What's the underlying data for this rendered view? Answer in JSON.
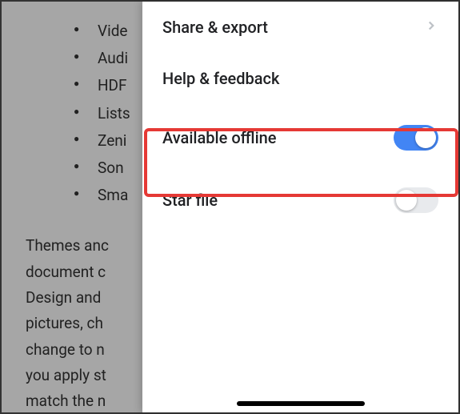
{
  "background": {
    "bullets": [
      "Vide",
      "Audi",
      "HDF",
      "Lists",
      "Zeni",
      "Son",
      "Sma"
    ],
    "paragraph": "Themes anc\ndocument c\nDesign and\npictures, ch\nchange to n\nyou apply st\nmatch the n"
  },
  "panel": {
    "share_export": "Share & export",
    "help_feedback": "Help & feedback",
    "available_offline": {
      "label": "Available offline",
      "state": "on"
    },
    "star_file": {
      "label": "Star file",
      "state": "off"
    }
  }
}
